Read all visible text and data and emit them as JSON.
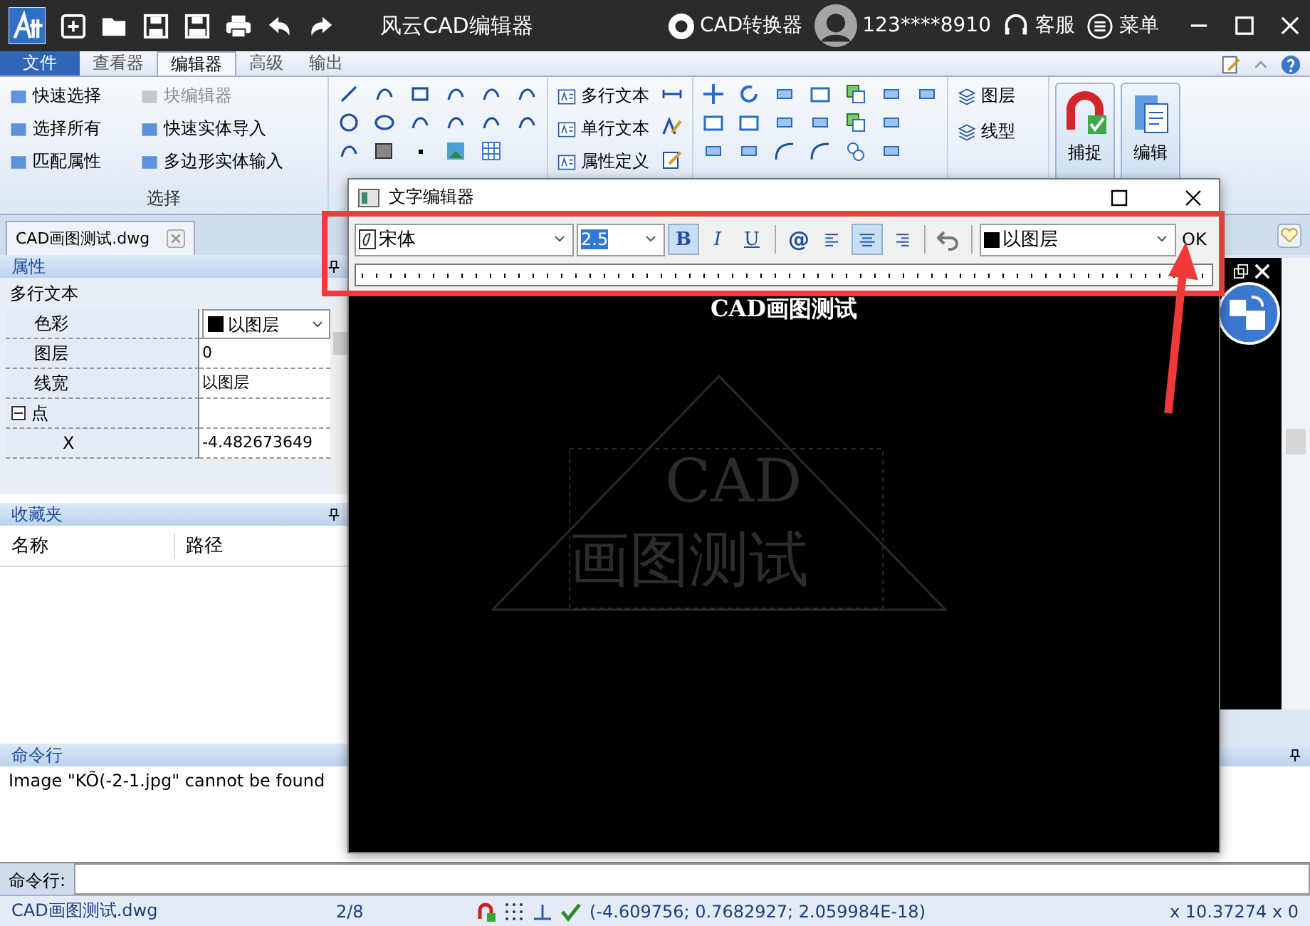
{
  "title_bar": {
    "title": "风云CAD编辑器",
    "converter": "CAD转换器",
    "user": "123****8910",
    "service": "客服",
    "menu": "菜单"
  },
  "menu_tabs": [
    {
      "label": "文件",
      "kind": "file",
      "selected": false
    },
    {
      "label": "查看器",
      "kind": "tab",
      "selected": false
    },
    {
      "label": "编辑器",
      "kind": "tab",
      "selected": true
    },
    {
      "label": "高级",
      "kind": "tab",
      "selected": false
    },
    {
      "label": "输出",
      "kind": "tab",
      "selected": false
    }
  ],
  "ribbon": {
    "select_group": {
      "title": "选择",
      "items": [
        {
          "label": "快速选择",
          "disabled": false
        },
        {
          "label": "块编辑器",
          "disabled": true
        },
        {
          "label": "选择所有",
          "disabled": false
        },
        {
          "label": "快速实体导入",
          "disabled": false
        },
        {
          "label": "匹配属性",
          "disabled": false
        },
        {
          "label": "多边形实体输入",
          "disabled": false
        }
      ]
    },
    "text_items": [
      "多行文本",
      "单行文本",
      "属性定义"
    ],
    "layer_items": [
      "图层",
      "线型"
    ],
    "big_buttons": [
      "捕捉",
      "编辑"
    ]
  },
  "doc_tab": {
    "label": "CAD画图测试.dwg"
  },
  "properties": {
    "title": "属性",
    "object_type": "多行文本",
    "rows": [
      {
        "name": "色彩",
        "value": "以图层",
        "kind": "dropdown"
      },
      {
        "name": "图层",
        "value": "0",
        "kind": "text"
      },
      {
        "name": "线宽",
        "value": "以图层",
        "kind": "text"
      },
      {
        "name": "点",
        "kind": "group",
        "expanded": true,
        "children": [
          {
            "name": "X",
            "value": "-4.482673649"
          }
        ]
      }
    ]
  },
  "favorites": {
    "title": "收藏夹",
    "columns": [
      "名称",
      "路径"
    ]
  },
  "command": {
    "title": "命令行",
    "log": "Image \"KÕ(-2-1.jpg\" cannot be found",
    "prompt": "命令行:"
  },
  "status_bar": {
    "file": "CAD画图测试.dwg",
    "page": "2/8",
    "coords": "(-4.609756; 0.7682927; 2.059984E-18)",
    "size": "x 10.37274 x 0"
  },
  "dialog": {
    "title": "文字编辑器",
    "font": "宋体",
    "size": "2.5",
    "styles": [
      {
        "label": "B",
        "kind": "bold",
        "selected": true
      },
      {
        "label": "I",
        "kind": "italic",
        "selected": false
      },
      {
        "label": "U",
        "kind": "underline",
        "selected": false
      }
    ],
    "symbol": "@",
    "align": [
      {
        "kind": "left",
        "selected": false
      },
      {
        "kind": "center",
        "selected": true
      },
      {
        "kind": "right",
        "selected": false
      }
    ],
    "layer_setting": "以图层",
    "ok": "OK",
    "canvas_text": "CAD画图测试",
    "ghost_texts": [
      "CAD",
      "画图测试"
    ]
  }
}
